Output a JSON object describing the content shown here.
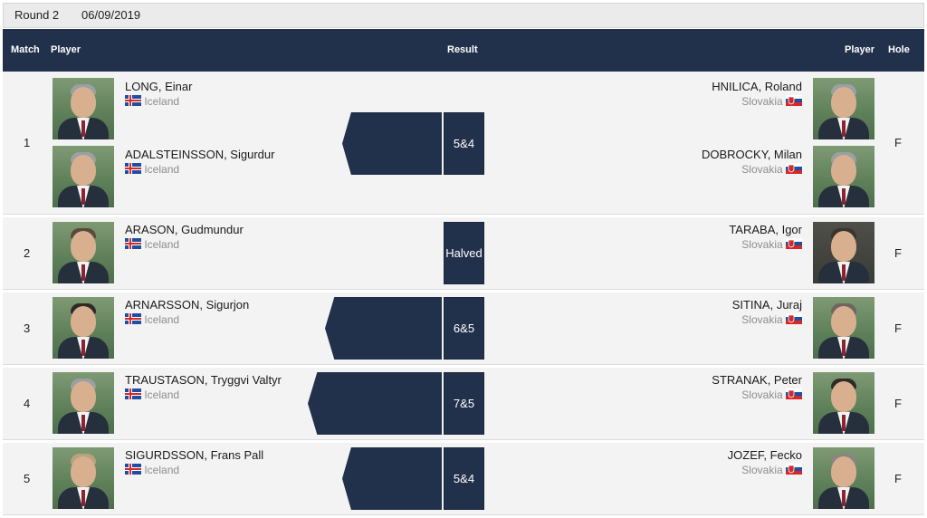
{
  "round": {
    "label": "Round 2",
    "date": "06/09/2019"
  },
  "header": {
    "match": "Match",
    "player_left": "Player",
    "result": "Result",
    "player_right": "Player",
    "hole": "Hole"
  },
  "colors": {
    "header_bg": "#22314b",
    "row_bg": "#f3f3f3",
    "result_bg": "#22314b"
  },
  "rows": [
    {
      "match": "1",
      "result": "5&4",
      "hole": "F",
      "left": [
        {
          "name": "LONG, Einar",
          "country": "Iceland"
        },
        {
          "name": "ADALSTEINSSON, Sigurdur",
          "country": "Iceland"
        }
      ],
      "right": [
        {
          "name": "HNILICA, Roland",
          "country": "Slovakia"
        },
        {
          "name": "DOBROCKY, Milan",
          "country": "Slovakia"
        }
      ]
    },
    {
      "match": "2",
      "result": "Halved",
      "hole": "F",
      "left": [
        {
          "name": "ARASON, Gudmundur",
          "country": "Iceland"
        }
      ],
      "right": [
        {
          "name": "TARABA, Igor",
          "country": "Slovakia"
        }
      ]
    },
    {
      "match": "3",
      "result": "6&5",
      "hole": "F",
      "left": [
        {
          "name": "ARNARSSON, Sigurjon",
          "country": "Iceland"
        }
      ],
      "right": [
        {
          "name": "SITINA, Juraj",
          "country": "Slovakia"
        }
      ]
    },
    {
      "match": "4",
      "result": "7&5",
      "hole": "F",
      "left": [
        {
          "name": "TRAUSTASON, Tryggvi Valtyr",
          "country": "Iceland"
        }
      ],
      "right": [
        {
          "name": "STRANAK, Peter",
          "country": "Slovakia"
        }
      ]
    },
    {
      "match": "5",
      "result": "5&4",
      "hole": "F",
      "left": [
        {
          "name": "SIGURDSSON, Frans Pall",
          "country": "Iceland"
        }
      ],
      "right": [
        {
          "name": "JOZEF, Fecko",
          "country": "Slovakia"
        }
      ]
    }
  ]
}
